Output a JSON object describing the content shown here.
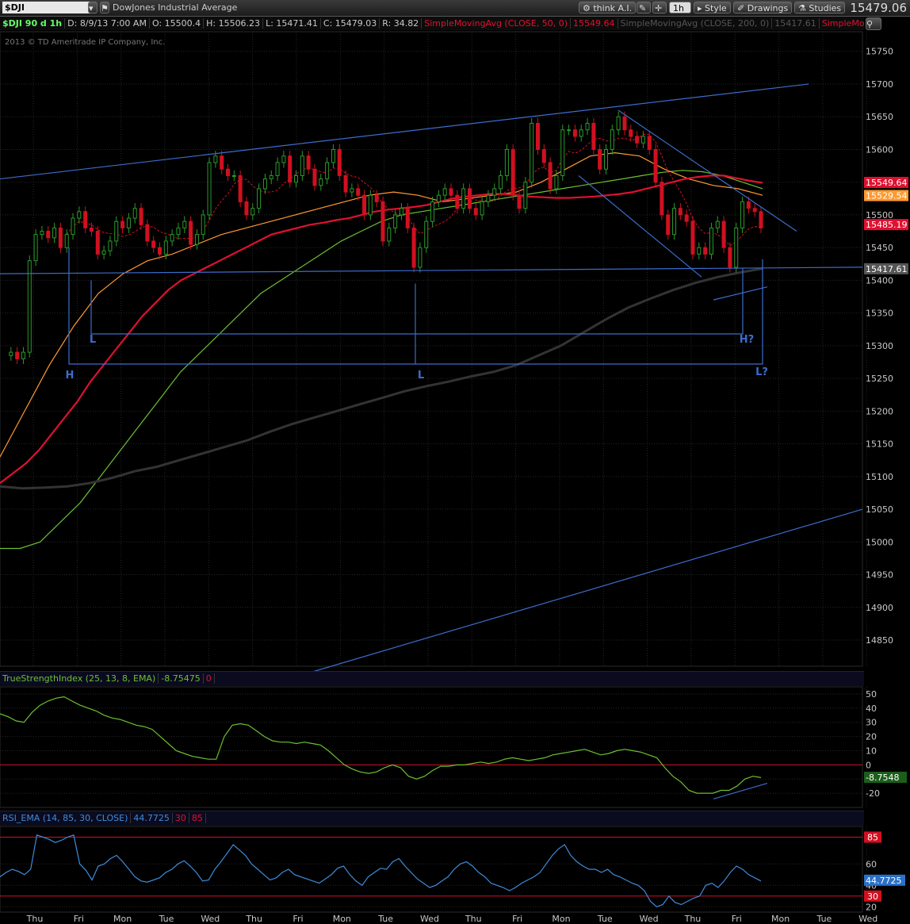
{
  "toolbar": {
    "symbol": "$DJI",
    "symbol_desc": "DowJones Industrial Average",
    "think_ai": "think A.I.",
    "timeframe": "1h",
    "style": "Style",
    "drawings": "Drawings",
    "studies": "Studies",
    "last_price": "15479.06"
  },
  "info": {
    "label": "$DJI 90 d 1h",
    "date": "D: 8/9/13 7:00 AM",
    "open": "O: 15500.4",
    "high": "H: 15506.23",
    "low": "L: 15471.41",
    "close": "C: 15479.03",
    "range": "R: 34.82",
    "sma50": "SimpleMovingAvg (CLOSE, 50, 0)",
    "sma50_val": "15549.64",
    "sma200": "SimpleMovingAvg (CLOSE, 200, 0)",
    "sma200_val": "15417.61",
    "sma_more": "SimpleMov"
  },
  "copyright": "2013 © TD Ameritrade IP Company, Inc.",
  "tsi_header": {
    "name": "TrueStrengthIndex (25, 13, 8, EMA)",
    "value": "-8.75475",
    "zero": "0"
  },
  "rsi_header": {
    "name": "RSI_EMA (14, 85, 30, CLOSE)",
    "value": "44.7725",
    "ob": "30",
    "os": "85"
  },
  "colors": {
    "sma50": "#e01030",
    "sma200": "#333333",
    "green": "#6cc030",
    "orange": "#ff9a30",
    "blue": "#3d6ccc",
    "up": "#2a9a2a",
    "down": "#d01020"
  },
  "chart_data": [
    {
      "type": "candlestick",
      "title": "$DJI 1h",
      "ylim": [
        14810,
        15780
      ],
      "y_ticks": [
        14850,
        14900,
        14950,
        15000,
        15050,
        15100,
        15150,
        15200,
        15250,
        15300,
        15350,
        15400,
        15450,
        15500,
        15550,
        15600,
        15650,
        15700,
        15750
      ],
      "x_ticks": [
        "Thu",
        "Fri",
        "Mon",
        "Tue",
        "Wed",
        "Thu",
        "Fri",
        "Mon",
        "Tue",
        "Wed",
        "Thu",
        "Fri",
        "Mon",
        "Tue",
        "Wed",
        "Thu",
        "Fri",
        "Mon",
        "Tue",
        "Wed"
      ],
      "price_labels": [
        {
          "text": "15549.64",
          "color": "#e01030"
        },
        {
          "text": "15529.54",
          "color": "#ff9a30"
        },
        {
          "text": "15485.19",
          "color": "#e01030"
        },
        {
          "text": "15417.61",
          "color": "#555555"
        }
      ],
      "annotations": [
        "H",
        "L",
        "L",
        "H?",
        "L?"
      ],
      "closes": [
        15285,
        15290,
        15280,
        15290,
        15430,
        15470,
        15475,
        15465,
        15480,
        15450,
        15470,
        15495,
        15505,
        15480,
        15475,
        15440,
        15445,
        15460,
        15490,
        15480,
        15495,
        15510,
        15485,
        15460,
        15450,
        15440,
        15460,
        15470,
        15480,
        15490,
        15455,
        15470,
        15500,
        15580,
        15590,
        15570,
        15560,
        15560,
        15520,
        15500,
        15510,
        15540,
        15555,
        15560,
        15580,
        15590,
        15550,
        15560,
        15590,
        15570,
        15545,
        15555,
        15580,
        15600,
        15560,
        15535,
        15540,
        15530,
        15500,
        15530,
        15520,
        15460,
        15480,
        15500,
        15510,
        15480,
        15420,
        15450,
        15490,
        15520,
        15530,
        15540,
        15530,
        15510,
        15540,
        15510,
        15500,
        15520,
        15530,
        15540,
        15560,
        15600,
        15530,
        15510,
        15550,
        15640,
        15600,
        15580,
        15540,
        15560,
        15630,
        15630,
        15620,
        15630,
        15640,
        15600,
        15570,
        15600,
        15630,
        15650,
        15630,
        15620,
        15610,
        15620,
        15600,
        15550,
        15500,
        15470,
        15510,
        15500,
        15490,
        15440,
        15450,
        15440,
        15480,
        15490,
        15450,
        15420,
        15480,
        15520,
        15510,
        15505,
        15480
      ],
      "sma50": [
        15090,
        15105,
        15120,
        15140,
        15165,
        15190,
        15215,
        15245,
        15270,
        15295,
        15320,
        15345,
        15365,
        15385,
        15400,
        15410,
        15420,
        15430,
        15440,
        15450,
        15460,
        15470,
        15475,
        15480,
        15485,
        15488,
        15492,
        15495,
        15500,
        15505,
        15508,
        15510,
        15512,
        15515,
        15520,
        15525,
        15528,
        15530,
        15532,
        15532,
        15530,
        15528,
        15527,
        15526,
        15526,
        15527,
        15528,
        15530,
        15532,
        15535,
        15540,
        15545,
        15550,
        15555,
        15558,
        15560,
        15560,
        15556,
        15552,
        15549
      ],
      "sma200": [
        15085,
        15082,
        15083,
        15085,
        15090,
        15098,
        15108,
        15115,
        15125,
        15135,
        15145,
        15155,
        15168,
        15180,
        15190,
        15200,
        15210,
        15220,
        15230,
        15238,
        15245,
        15253,
        15260,
        15270,
        15285,
        15300,
        15320,
        15340,
        15358,
        15372,
        15385,
        15396,
        15405,
        15412,
        15418
      ],
      "ema_green": [
        14990,
        14990,
        15000,
        15030,
        15060,
        15100,
        15140,
        15180,
        15220,
        15260,
        15290,
        15320,
        15350,
        15380,
        15400,
        15420,
        15440,
        15460,
        15475,
        15490,
        15500,
        15505,
        15510,
        15515,
        15520,
        15525,
        15530,
        15535,
        15540,
        15545,
        15550,
        15555,
        15560,
        15565,
        15568,
        15566,
        15560,
        15550,
        15540
      ],
      "ema_orange": [
        15130,
        15200,
        15270,
        15330,
        15380,
        15410,
        15430,
        15440,
        15455,
        15470,
        15480,
        15490,
        15500,
        15510,
        15520,
        15530,
        15535,
        15530,
        15520,
        15525,
        15530,
        15535,
        15550,
        15570,
        15590,
        15595,
        15590,
        15570,
        15555,
        15545,
        15540,
        15530
      ]
    },
    {
      "type": "line",
      "title": "TrueStrengthIndex (25, 13, 8, EMA)",
      "ylim": [
        -30,
        55
      ],
      "y_ticks": [
        -20,
        -10,
        0,
        10,
        20,
        30,
        40,
        50
      ],
      "last_value": "-8.7548",
      "values": [
        36,
        34,
        31,
        30,
        37,
        42,
        45,
        47,
        48,
        45,
        42,
        40,
        38,
        35,
        33,
        32,
        30,
        28,
        27,
        25,
        20,
        15,
        10,
        8,
        6,
        5,
        4,
        4,
        20,
        28,
        29,
        28,
        24,
        20,
        17,
        16,
        16,
        15,
        16,
        15,
        14,
        10,
        5,
        0,
        -3,
        -5,
        -6,
        -5,
        -2,
        0,
        -2,
        -8,
        -10,
        -8,
        -4,
        -1,
        -1,
        0,
        0,
        1,
        2,
        1,
        2,
        4,
        5,
        4,
        3,
        4,
        5,
        7,
        8,
        9,
        10,
        11,
        9,
        7,
        8,
        10,
        11,
        10,
        9,
        7,
        5,
        -2,
        -8,
        -12,
        -18,
        -20,
        -20,
        -20,
        -18,
        -18,
        -15,
        -10,
        -8,
        -9
      ]
    },
    {
      "type": "line",
      "title": "RSI_EMA (14, 85, 30, CLOSE)",
      "ylim": [
        15,
        95
      ],
      "y_ticks": [
        20,
        40,
        60
      ],
      "levels": [
        30,
        85
      ],
      "last_value": "44.7725",
      "values": [
        48,
        52,
        55,
        53,
        50,
        55,
        87,
        85,
        83,
        80,
        82,
        85,
        87,
        60,
        54,
        45,
        58,
        60,
        65,
        68,
        62,
        55,
        48,
        44,
        43,
        45,
        47,
        52,
        55,
        60,
        63,
        58,
        52,
        44,
        45,
        55,
        62,
        70,
        78,
        73,
        68,
        60,
        55,
        50,
        45,
        47,
        52,
        55,
        50,
        48,
        46,
        44,
        42,
        46,
        50,
        56,
        58,
        50,
        44,
        40,
        48,
        52,
        56,
        55,
        62,
        65,
        58,
        52,
        46,
        42,
        38,
        40,
        44,
        48,
        55,
        60,
        62,
        58,
        52,
        48,
        42,
        40,
        38,
        35,
        38,
        42,
        45,
        48,
        52,
        60,
        68,
        74,
        78,
        68,
        62,
        58,
        55,
        55,
        52,
        55,
        50,
        48,
        45,
        42,
        40,
        35,
        25,
        20,
        22,
        30,
        24,
        22,
        25,
        28,
        30,
        40,
        42,
        38,
        44,
        52,
        58,
        55,
        50,
        47,
        44
      ]
    }
  ]
}
